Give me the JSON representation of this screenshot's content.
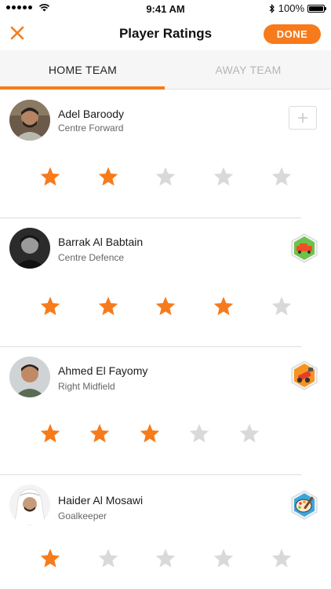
{
  "status": {
    "time": "9:41 AM",
    "battery": "100%"
  },
  "header": {
    "title": "Player Ratings",
    "done_label": "DONE"
  },
  "tabs": [
    {
      "label": "HOME TEAM"
    },
    {
      "label": "AWAY TEAM"
    }
  ],
  "colors": {
    "accent": "#f77b1b",
    "star_on": "#f77b1b",
    "star_off": "#d9d9d9"
  },
  "players": [
    {
      "name": "Adel Baroody",
      "position": "Centre Forward",
      "rating": 2,
      "badge": "add-icon"
    },
    {
      "name": "Barrak Al Babtain",
      "position": "Centre Defence",
      "rating": 4,
      "badge": "car-badge-icon"
    },
    {
      "name": "Ahmed El Fayomy",
      "position": "Right Midfield",
      "rating": 3,
      "badge": "cannon-badge-icon"
    },
    {
      "name": "Haider Al Mosawi",
      "position": "Goalkeeper",
      "rating": 1,
      "badge": "palette-badge-icon"
    }
  ]
}
